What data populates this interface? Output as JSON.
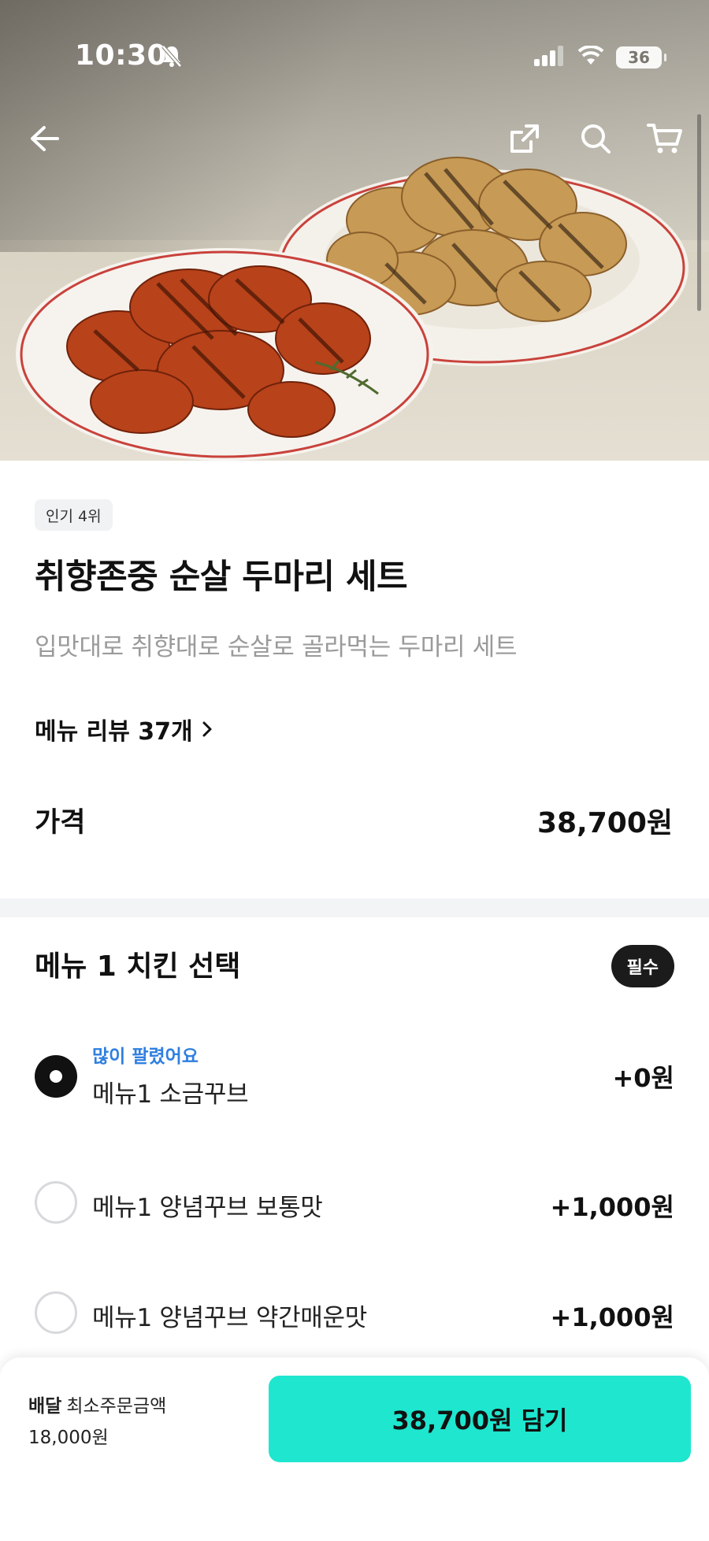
{
  "status_bar": {
    "time": "10:30",
    "battery": "36"
  },
  "nav": {
    "back": "back-arrow-icon",
    "share": "share-icon",
    "search": "search-icon",
    "cart": "cart-icon"
  },
  "product": {
    "rank_badge": "인기 4위",
    "title": "취향존중 순살 두마리 세트",
    "description": "입맛대로 취향대로 순살로 골라먹는 두마리 세트",
    "review_link": "메뉴 리뷰 37개",
    "price_label": "가격",
    "price": "38,700원"
  },
  "option_group": {
    "title": "메뉴 1 치킨 선택",
    "required_badge": "필수",
    "options": [
      {
        "tag": "많이 팔렸어요",
        "label": "메뉴1 소금꾸브",
        "price": "+0원",
        "selected": true
      },
      {
        "label": "메뉴1 양념꾸브 보통맛",
        "price": "+1,000원",
        "selected": false
      },
      {
        "label": "메뉴1 양념꾸브 약간매운맛",
        "price": "+1,000원",
        "selected": false
      }
    ]
  },
  "bottom_bar": {
    "delivery_label": "배달",
    "min_order_label": "최소주문금액",
    "min_order_amount": "18,000원",
    "cart_button": "38,700원 담기"
  },
  "colors": {
    "accent": "#1ee6cf",
    "tag_blue": "#2f7fe0",
    "divider": "#f3f4f6"
  }
}
